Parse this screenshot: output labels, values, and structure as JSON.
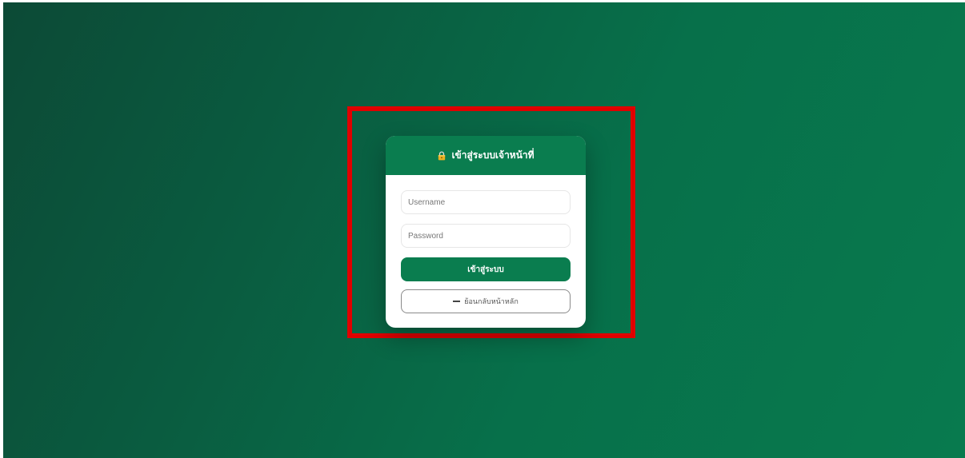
{
  "login": {
    "title": "เข้าสู่ระบบเจ้าหน้าที่",
    "title_icon": "lock-icon",
    "username_placeholder": "Username",
    "password_placeholder": "Password",
    "submit_label": "เข้าสู่ระบบ",
    "back_label": "ย้อนกลับหน้าหลัก",
    "back_icon": "arrow-left-icon"
  },
  "colors": {
    "brand": "#0a7d4f",
    "highlight": "#e00000",
    "background_dark": "#0c4a36",
    "background_light": "#087a4e"
  }
}
